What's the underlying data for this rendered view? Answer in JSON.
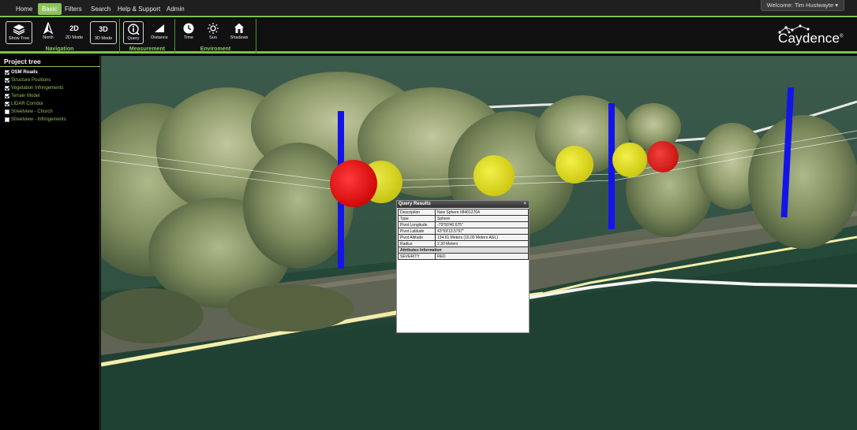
{
  "nav": {
    "items": [
      "Home",
      "Basic",
      "Filters",
      "Search",
      "Help & Support",
      "Admin"
    ],
    "active_index": 1,
    "welcome": "Welcome: Tim Hustwayte ▾"
  },
  "toolbar": {
    "groups": [
      {
        "name": "Navigation",
        "buttons": [
          {
            "label": "Show Tree",
            "icon": "layers-icon"
          },
          {
            "label": "North",
            "icon": "north-arrow-icon"
          },
          {
            "label": "2D Mode",
            "icon_text": "2D"
          },
          {
            "label": "3D Mode",
            "icon_text": "3D"
          }
        ]
      },
      {
        "name": "Measurement",
        "buttons": [
          {
            "label": "Query",
            "icon": "query-info-icon"
          },
          {
            "label": "Distance",
            "icon": "ruler-icon"
          }
        ]
      },
      {
        "name": "Enviroment",
        "buttons": [
          {
            "label": "Time",
            "icon": "clock-icon"
          },
          {
            "label": "Sun",
            "icon": "sun-icon"
          },
          {
            "label": "Shadows",
            "icon": "house-shadow-icon"
          }
        ]
      }
    ],
    "logo_text": "Caydence",
    "logo_mark": "®"
  },
  "sidebar": {
    "title": "Project tree",
    "items": [
      {
        "label": "OSM Roads",
        "checked": true,
        "bold": true
      },
      {
        "label": "Structure Positions",
        "checked": true,
        "bold": false
      },
      {
        "label": "Vegetation Infringements",
        "checked": true,
        "bold": false
      },
      {
        "label": "Terrain Model",
        "checked": true,
        "bold": false
      },
      {
        "label": "LIDAR Corridor",
        "checked": true,
        "bold": false
      },
      {
        "label": "Streetview - Church",
        "checked": false,
        "bold": false
      },
      {
        "label": "Streetview - Infringements",
        "checked": false,
        "bold": false
      }
    ]
  },
  "query": {
    "title": "Query Results",
    "close": "×",
    "rows": [
      {
        "key": "Description",
        "value": "New Sphere #84012704"
      },
      {
        "key": "Type",
        "value": "Sphere"
      },
      {
        "key": "Pivot Longitude",
        "value": "-79°50'40.675\""
      },
      {
        "key": "Pivot Latitude",
        "value": "43°59'13.5797\""
      },
      {
        "key": "Pivot Altitude",
        "value": "134.61 Meters (10.00 Meters AGL)"
      },
      {
        "key": "Radius",
        "value": "2.30 Meters"
      }
    ],
    "section": "Attributes Information",
    "attributes": [
      {
        "key": "SEVERITY",
        "value": "RED"
      }
    ]
  },
  "colors": {
    "accent": "#8cc25a",
    "marker_red": "#e01010",
    "marker_yellow": "#e6e01a",
    "pole_blue": "#1010e8",
    "road_white": "#ffffff",
    "road_cream": "#f3eeaa"
  }
}
